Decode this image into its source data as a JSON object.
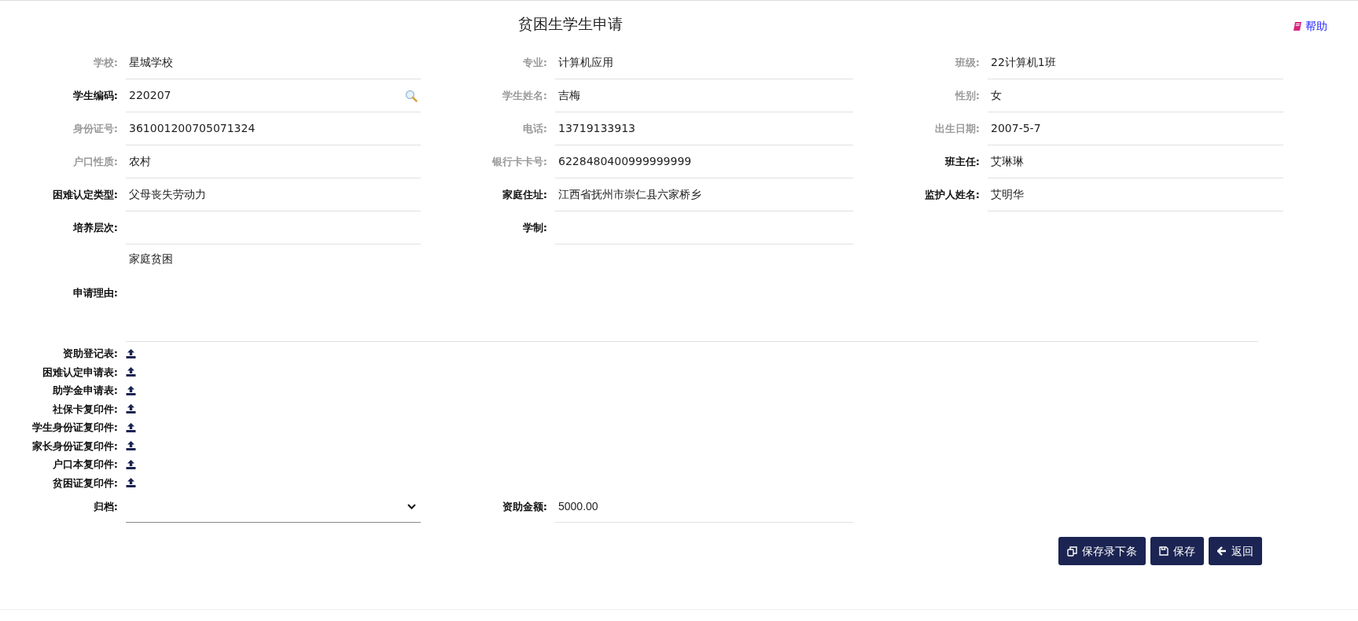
{
  "header": {
    "title": "贫困生学生申请",
    "help": "帮助"
  },
  "rows": [
    [
      {
        "label": "学校:",
        "value": "星城学校",
        "disabled": true,
        "kind": "text"
      },
      {
        "label": "专业:",
        "value": "计算机应用",
        "disabled": true,
        "kind": "text"
      },
      {
        "label": "班级:",
        "value": "22计算机1班",
        "disabled": true,
        "kind": "text"
      }
    ],
    [
      {
        "label": "学生编码:",
        "value": "220207",
        "disabled": false,
        "kind": "search"
      },
      {
        "label": "学生姓名:",
        "value": "吉梅",
        "disabled": true,
        "kind": "text"
      },
      {
        "label": "性别:",
        "value": "女",
        "disabled": true,
        "kind": "text"
      }
    ],
    [
      {
        "label": "身份证号:",
        "value": "361001200705071324",
        "disabled": true,
        "kind": "text"
      },
      {
        "label": "电话:",
        "value": "13719133913",
        "disabled": true,
        "kind": "text"
      },
      {
        "label": "出生日期:",
        "value": "2007-5-7",
        "disabled": true,
        "kind": "text"
      }
    ],
    [
      {
        "label": "户口性质:",
        "value": "农村",
        "disabled": true,
        "kind": "text"
      },
      {
        "label": "银行卡卡号:",
        "value": "6228480400999999999",
        "disabled": true,
        "kind": "text"
      },
      {
        "label": "班主任:",
        "value": "艾琳琳",
        "disabled": false,
        "kind": "text"
      }
    ],
    [
      {
        "label": "困难认定类型:",
        "value": "父母丧失劳动力",
        "disabled": false,
        "kind": "text"
      },
      {
        "label": "家庭住址:",
        "value": "江西省抚州市崇仁县六家桥乡",
        "disabled": false,
        "kind": "text"
      },
      {
        "label": "监护人姓名:",
        "value": "艾明华",
        "disabled": false,
        "kind": "text"
      }
    ],
    [
      {
        "label": "培养层次:",
        "disabled": false,
        "kind": "text"
      },
      {
        "label": "学制:",
        "disabled": false,
        "kind": "text"
      }
    ]
  ],
  "reason": {
    "label": "申请理由:",
    "value": "家庭贫困"
  },
  "attachments": [
    {
      "label": "资助登记表:"
    },
    {
      "label": "困难认定申请表:"
    },
    {
      "label": "助学金申请表:"
    },
    {
      "label": "社保卡复印件:"
    },
    {
      "label": "学生身份证复印件:"
    },
    {
      "label": "家长身份证复印件:"
    },
    {
      "label": "户口本复印件:"
    },
    {
      "label": "贫困证复印件:"
    }
  ],
  "archive": {
    "label": "归档:"
  },
  "amount": {
    "label": "资助金额:",
    "value": "5000.00"
  },
  "buttons": [
    {
      "label": "保存录下条",
      "kind": "save-next"
    },
    {
      "label": "保存",
      "kind": "save"
    },
    {
      "label": "返回",
      "kind": "back"
    }
  ]
}
